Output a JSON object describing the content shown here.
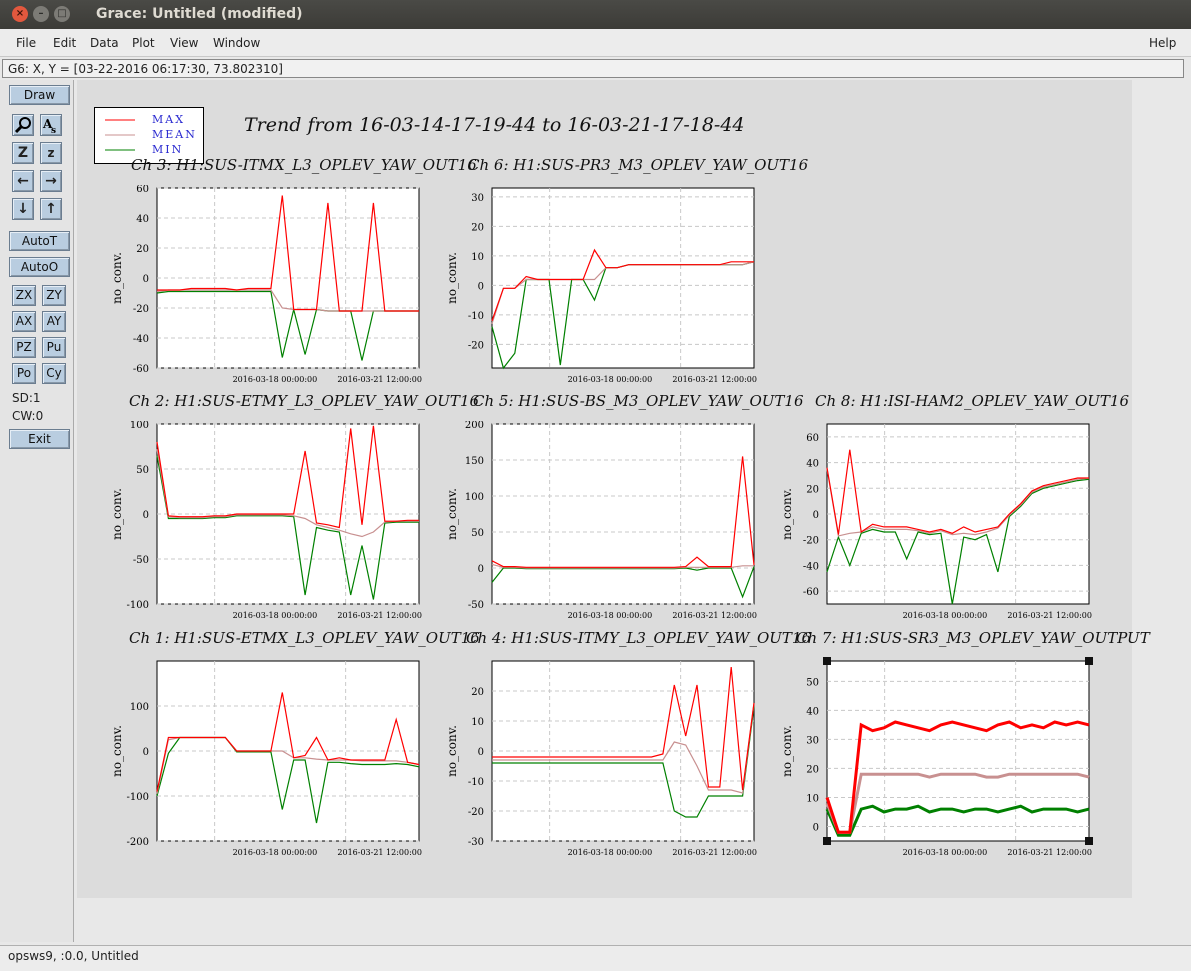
{
  "window": {
    "title": "Grace: Untitled (modified)"
  },
  "menu": {
    "items": [
      "File",
      "Edit",
      "Data",
      "Plot",
      "View",
      "Window"
    ],
    "help": "Help"
  },
  "locator": {
    "text": "G6: X, Y = [03-22-2016 06:17:30, 73.802310]"
  },
  "toolbar": {
    "draw": "Draw",
    "autot": "AutoT",
    "autoo": "AutoO",
    "pairs": [
      [
        "ZX",
        "ZY"
      ],
      [
        "AX",
        "AY"
      ],
      [
        "PZ",
        "Pu"
      ],
      [
        "Po",
        "Cy"
      ]
    ],
    "sd": "SD:1",
    "cw": "CW:0",
    "exit": "Exit"
  },
  "status": {
    "text": "opsws9, :0.0, Untitled"
  },
  "colors": {
    "max": "#ff0000",
    "mean": "#c89090",
    "min": "#008000"
  },
  "legend": {
    "max": "MAX",
    "mean": "MEAN",
    "min": "MIN"
  },
  "page": {
    "title": "Trend from 16-03-14-17-19-44 to 16-03-21-17-18-44"
  },
  "chart_data": [
    {
      "type": "line",
      "title": "Ch 3: H1:SUS-ITMX_L3_OPLEV_YAW_OUT16",
      "ylabel": "no_conv.",
      "ylim": [
        -60,
        60
      ],
      "yticks": [
        60,
        40,
        20,
        0,
        -20,
        -40,
        -60
      ],
      "xticks": [
        "2016-03-18 00:00:00",
        "2016-03-21 12:00:00"
      ],
      "series": [
        {
          "name": "MAX",
          "values": [
            -8,
            -8,
            -8,
            -7,
            -7,
            -7,
            -7,
            -8,
            -7,
            -7,
            -7,
            55,
            -21,
            -21,
            -21,
            50,
            -22,
            -22,
            -22,
            50,
            -22,
            -22,
            -22,
            -22
          ]
        },
        {
          "name": "MEAN",
          "values": [
            -9,
            -8,
            -8,
            -8,
            -8,
            -8,
            -8,
            -8,
            -8,
            -8,
            -8,
            -20,
            -21,
            -21,
            -21,
            -22,
            -22,
            -22,
            -22,
            -22,
            -22,
            -22,
            -22,
            -22
          ]
        },
        {
          "name": "MIN",
          "values": [
            -10,
            -9,
            -9,
            -9,
            -9,
            -9,
            -9,
            -9,
            -9,
            -9,
            -9,
            -53,
            -21,
            -51,
            -21,
            -22,
            -22,
            -22,
            -55,
            -22,
            -22,
            -22,
            -22,
            -22
          ]
        }
      ]
    },
    {
      "type": "line",
      "title": "Ch 6: H1:SUS-PR3_M3_OPLEV_YAW_OUT16",
      "ylabel": "no_conv.",
      "ylim": [
        -28,
        33
      ],
      "yticks": [
        30,
        20,
        10,
        0,
        -10,
        -20
      ],
      "xticks": [
        "2016-03-18 00:00:00",
        "2016-03-21 12:00:00"
      ],
      "series": [
        {
          "name": "MAX",
          "values": [
            -12,
            -1,
            -1,
            3,
            2,
            2,
            2,
            2,
            2,
            12,
            6,
            6,
            7,
            7,
            7,
            7,
            7,
            7,
            7,
            7,
            7,
            8,
            8,
            8
          ]
        },
        {
          "name": "MEAN",
          "values": [
            -13,
            -1,
            -1,
            2,
            2,
            2,
            2,
            2,
            2,
            2,
            6,
            6,
            7,
            7,
            7,
            7,
            7,
            7,
            7,
            7,
            7,
            7,
            7,
            8
          ]
        },
        {
          "name": "MIN",
          "values": [
            -14,
            -28,
            -23,
            2,
            2,
            2,
            -27,
            2,
            2,
            -5,
            6,
            6,
            7,
            7,
            7,
            7,
            7,
            7,
            7,
            7,
            7,
            7,
            7,
            8
          ]
        }
      ]
    },
    {
      "type": "line",
      "title": "Ch 2: H1:SUS-ETMY_L3_OPLEV_YAW_OUT16",
      "ylabel": "no_conv.",
      "ylim": [
        -100,
        100
      ],
      "yticks": [
        100,
        50,
        0,
        -50,
        -100
      ],
      "xticks": [
        "2016-03-18 00:00:00",
        "2016-03-21 12:00:00"
      ],
      "series": [
        {
          "name": "MAX",
          "values": [
            80,
            -2,
            -3,
            -3,
            -3,
            -2,
            -2,
            0,
            0,
            0,
            0,
            0,
            0,
            70,
            -10,
            -12,
            -15,
            95,
            -12,
            98,
            -8,
            -8,
            -7,
            -7
          ]
        },
        {
          "name": "MEAN",
          "values": [
            72,
            -3,
            -4,
            -4,
            -4,
            -3,
            -3,
            -1,
            -1,
            -1,
            -1,
            -1,
            -2,
            -5,
            -12,
            -15,
            -18,
            -22,
            -25,
            -20,
            -9,
            -8,
            -8,
            -8
          ]
        },
        {
          "name": "MIN",
          "values": [
            65,
            -5,
            -5,
            -5,
            -5,
            -4,
            -4,
            -2,
            -2,
            -2,
            -2,
            -2,
            -3,
            -90,
            -15,
            -18,
            -20,
            -90,
            -35,
            -95,
            -10,
            -9,
            -9,
            -9
          ]
        }
      ]
    },
    {
      "type": "line",
      "title": "Ch 5: H1:SUS-BS_M3_OPLEV_YAW_OUT16",
      "ylabel": "no_conv.",
      "ylim": [
        -50,
        200
      ],
      "yticks": [
        200,
        150,
        100,
        50,
        0,
        -50
      ],
      "xticks": [
        "2016-03-18 00:00:00",
        "2016-03-21 12:00:00"
      ],
      "series": [
        {
          "name": "MAX",
          "values": [
            10,
            2,
            2,
            1,
            1,
            1,
            1,
            1,
            1,
            1,
            1,
            1,
            1,
            1,
            1,
            1,
            1,
            2,
            15,
            2,
            2,
            2,
            155,
            4
          ]
        },
        {
          "name": "MEAN",
          "values": [
            5,
            1,
            1,
            0,
            0,
            0,
            0,
            0,
            0,
            0,
            0,
            0,
            0,
            0,
            0,
            0,
            0,
            1,
            1,
            1,
            1,
            1,
            3,
            3
          ]
        },
        {
          "name": "MIN",
          "values": [
            -20,
            0,
            0,
            -1,
            -1,
            -1,
            -1,
            -1,
            -1,
            -1,
            -1,
            -1,
            -1,
            -1,
            -1,
            -1,
            -1,
            0,
            -3,
            0,
            0,
            0,
            -40,
            2
          ]
        }
      ]
    },
    {
      "type": "line",
      "title": "Ch 8: H1:ISI-HAM2_OPLEV_YAW_OUT16",
      "ylabel": "no_conv.",
      "ylim": [
        -70,
        70
      ],
      "yticks": [
        60,
        40,
        20,
        0,
        -20,
        -40,
        -60
      ],
      "xticks": [
        "2016-03-18 00:00:00",
        "2016-03-21 12:00:00"
      ],
      "series": [
        {
          "name": "MAX",
          "values": [
            36,
            -16,
            50,
            -14,
            -8,
            -10,
            -10,
            -10,
            -12,
            -14,
            -12,
            -15,
            -10,
            -14,
            -12,
            -10,
            0,
            8,
            18,
            22,
            24,
            26,
            28,
            28
          ]
        },
        {
          "name": "MEAN",
          "values": [
            35,
            -17,
            -15,
            -14,
            -10,
            -12,
            -12,
            -12,
            -13,
            -15,
            -13,
            -16,
            -15,
            -16,
            -14,
            -11,
            -1,
            7,
            17,
            21,
            23,
            25,
            27,
            28
          ]
        },
        {
          "name": "MIN",
          "values": [
            -45,
            -18,
            -40,
            -15,
            -12,
            -14,
            -14,
            -35,
            -14,
            -16,
            -15,
            -72,
            -18,
            -20,
            -16,
            -45,
            -2,
            6,
            16,
            20,
            22,
            24,
            26,
            27
          ]
        }
      ]
    },
    {
      "type": "line",
      "title": "Ch 1: H1:SUS-ETMX_L3_OPLEV_YAW_OUT16",
      "ylabel": "no_conv.",
      "ylim": [
        -200,
        200
      ],
      "yticks": [
        100,
        0,
        -100,
        -200
      ],
      "xticks": [
        "2016-03-18 00:00:00",
        "2016-03-21 12:00:00"
      ],
      "series": [
        {
          "name": "MAX",
          "values": [
            -90,
            30,
            30,
            30,
            30,
            30,
            30,
            0,
            0,
            0,
            0,
            130,
            -15,
            -10,
            30,
            -20,
            -15,
            -20,
            -20,
            -20,
            -20,
            70,
            -25,
            -30
          ]
        },
        {
          "name": "MEAN",
          "values": [
            -95,
            25,
            30,
            30,
            30,
            30,
            30,
            0,
            0,
            0,
            0,
            0,
            -15,
            -15,
            -18,
            -20,
            -20,
            -20,
            -22,
            -22,
            -22,
            -22,
            -25,
            -30
          ]
        },
        {
          "name": "MIN",
          "values": [
            -100,
            -5,
            30,
            30,
            30,
            30,
            30,
            -2,
            -2,
            -2,
            -2,
            -130,
            -20,
            -20,
            -160,
            -25,
            -25,
            -28,
            -30,
            -30,
            -30,
            -28,
            -30,
            -35
          ]
        }
      ]
    },
    {
      "type": "line",
      "title": "Ch 4: H1:SUS-ITMY_L3_OPLEV_YAW_OUT16",
      "ylabel": "no_conv.",
      "ylim": [
        -30,
        30
      ],
      "yticks": [
        20,
        10,
        0,
        -10,
        -20,
        -30
      ],
      "xticks": [
        "2016-03-18 00:00:00",
        "2016-03-21 12:00:00"
      ],
      "series": [
        {
          "name": "MAX",
          "values": [
            -2,
            -2,
            -2,
            -2,
            -2,
            -2,
            -2,
            -2,
            -2,
            -2,
            -2,
            -2,
            -2,
            -2,
            -2,
            -1,
            22,
            5,
            22,
            -12,
            -12,
            28,
            -13,
            16
          ]
        },
        {
          "name": "MEAN",
          "values": [
            -3,
            -3,
            -3,
            -3,
            -3,
            -3,
            -3,
            -3,
            -3,
            -3,
            -3,
            -3,
            -3,
            -3,
            -3,
            -3,
            3,
            2,
            -5,
            -13,
            -13,
            -13,
            -14,
            16
          ]
        },
        {
          "name": "MIN",
          "values": [
            -4,
            -4,
            -4,
            -4,
            -4,
            -4,
            -4,
            -4,
            -4,
            -4,
            -4,
            -4,
            -4,
            -4,
            -4,
            -4,
            -20,
            -22,
            -22,
            -15,
            -15,
            -15,
            -15,
            15
          ]
        }
      ]
    },
    {
      "type": "line",
      "title": "Ch 7: H1:SUS-SR3_M3_OPLEV_YAW_OUTPUT",
      "ylabel": "no_conv.",
      "ylim": [
        -5,
        57
      ],
      "yticks": [
        50,
        40,
        30,
        20,
        10,
        0
      ],
      "xticks": [
        "2016-03-18 00:00:00",
        "2016-03-21 12:00:00"
      ],
      "series": [
        {
          "name": "MAX",
          "values": [
            10,
            -2,
            -2,
            35,
            33,
            34,
            36,
            35,
            34,
            33,
            35,
            36,
            35,
            34,
            33,
            35,
            36,
            34,
            35,
            34,
            36,
            35,
            36,
            35
          ]
        },
        {
          "name": "MEAN",
          "values": [
            8,
            -2,
            -2,
            18,
            18,
            18,
            18,
            18,
            18,
            17,
            18,
            18,
            18,
            18,
            17,
            17,
            18,
            18,
            18,
            18,
            18,
            18,
            18,
            17
          ]
        },
        {
          "name": "MIN",
          "values": [
            6,
            -3,
            -3,
            6,
            7,
            5,
            6,
            6,
            7,
            5,
            6,
            6,
            5,
            6,
            6,
            5,
            6,
            7,
            5,
            6,
            6,
            6,
            5,
            6
          ]
        }
      ]
    }
  ]
}
